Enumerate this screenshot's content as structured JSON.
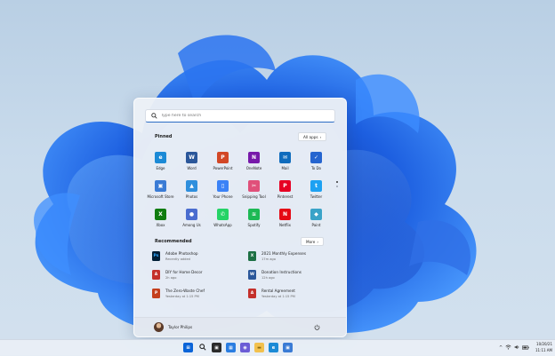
{
  "search": {
    "placeholder": "Type here to search"
  },
  "pinned": {
    "title": "Pinned",
    "all_apps_label": "All apps",
    "apps": [
      {
        "label": "Edge",
        "icon": "edge-icon",
        "color": "#1b8ad6"
      },
      {
        "label": "Word",
        "icon": "word-icon",
        "color": "#2b579a"
      },
      {
        "label": "PowerPoint",
        "icon": "powerpoint-icon",
        "color": "#d24726"
      },
      {
        "label": "OneNote",
        "icon": "onenote-icon",
        "color": "#7719aa"
      },
      {
        "label": "Mail",
        "icon": "mail-icon",
        "color": "#0f6cbd"
      },
      {
        "label": "To Do",
        "icon": "todo-icon",
        "color": "#2564cf"
      },
      {
        "label": "Microsoft Store",
        "icon": "store-icon",
        "color": "#3a7bd5"
      },
      {
        "label": "Photos",
        "icon": "photos-icon",
        "color": "#2f8fdd"
      },
      {
        "label": "Your Phone",
        "icon": "phone-icon",
        "color": "#3b82f6"
      },
      {
        "label": "Snipping Tool",
        "icon": "snipping-tool-icon",
        "color": "#e0507a"
      },
      {
        "label": "Pinterest",
        "icon": "pinterest-icon",
        "color": "#e60023"
      },
      {
        "label": "Twitter",
        "icon": "twitter-icon",
        "color": "#1da1f2"
      },
      {
        "label": "Xbox",
        "icon": "xbox-icon",
        "color": "#107c10"
      },
      {
        "label": "Among Us",
        "icon": "among-us-icon",
        "color": "#4a6ccf"
      },
      {
        "label": "WhatsApp",
        "icon": "whatsapp-icon",
        "color": "#25d366"
      },
      {
        "label": "Spotify",
        "icon": "spotify-icon",
        "color": "#1db954"
      },
      {
        "label": "Netflix",
        "icon": "netflix-icon",
        "color": "#e50914"
      },
      {
        "label": "Paint",
        "icon": "paint-icon",
        "color": "#3aa3c8"
      }
    ]
  },
  "recommended": {
    "title": "Recommended",
    "more_label": "More",
    "items": [
      {
        "name": "Adobe Photoshop",
        "sub": "Recently added",
        "icon": "photoshop-icon",
        "color": "#001e36"
      },
      {
        "name": "2021 Monthly Expenses",
        "sub": "17m ago",
        "icon": "excel-file-icon",
        "color": "#1d7044"
      },
      {
        "name": "DIY for Home Decor",
        "sub": "2h ago",
        "icon": "pdf-file-icon",
        "color": "#c4302b"
      },
      {
        "name": "Donation Instructions",
        "sub": "12h ago",
        "icon": "word-file-icon",
        "color": "#2b579a"
      },
      {
        "name": "The Zero-Waste Chef",
        "sub": "Yesterday at 1:15 PM",
        "icon": "powerpoint-file-icon",
        "color": "#c43e1c"
      },
      {
        "name": "Rental Agreement",
        "sub": "Yesterday at 1:15 PM",
        "icon": "pdf-file-icon",
        "color": "#c4302b"
      }
    ]
  },
  "user": {
    "name": "Taylor Philips"
  },
  "taskbar": {
    "icons": [
      {
        "name": "start-button",
        "icon": "windows-icon"
      },
      {
        "name": "search-button",
        "icon": "search-icon"
      },
      {
        "name": "task-view-button",
        "icon": "task-view-icon"
      },
      {
        "name": "widgets-button",
        "icon": "widgets-icon"
      },
      {
        "name": "chat-button",
        "icon": "chat-icon"
      },
      {
        "name": "file-explorer-button",
        "icon": "folder-icon"
      },
      {
        "name": "edge-button",
        "icon": "edge-icon"
      },
      {
        "name": "store-button",
        "icon": "store-icon"
      }
    ],
    "clock": {
      "date": "10/20/21",
      "time": "11:11 AM"
    }
  }
}
